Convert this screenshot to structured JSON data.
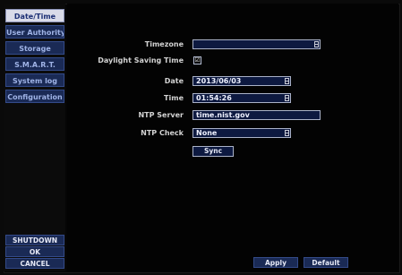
{
  "sidebar": {
    "tabs": [
      {
        "label": "Date/Time",
        "active": true
      },
      {
        "label": "User Authority",
        "active": false
      },
      {
        "label": "Storage",
        "active": false
      },
      {
        "label": "S.M.A.R.T.",
        "active": false
      },
      {
        "label": "System log",
        "active": false
      },
      {
        "label": "Configuration",
        "active": false
      }
    ],
    "shutdown_label": "SHUTDOWN",
    "ok_label": "OK",
    "cancel_label": "CANCEL"
  },
  "form": {
    "timezone_label": "Timezone",
    "timezone_value": "",
    "dst_label": "Daylight Saving Time",
    "dst_checked": "☑",
    "date_label": "Date",
    "date_value": "2013/06/03",
    "time_label": "Time",
    "time_value": "01:54:26",
    "ntp_server_label": "NTP Server",
    "ntp_server_value": "time.nist.gov",
    "ntp_check_label": "NTP Check",
    "ntp_check_value": "None",
    "sync_label": "Sync"
  },
  "footer": {
    "apply_label": "Apply",
    "default_label": "Default"
  }
}
